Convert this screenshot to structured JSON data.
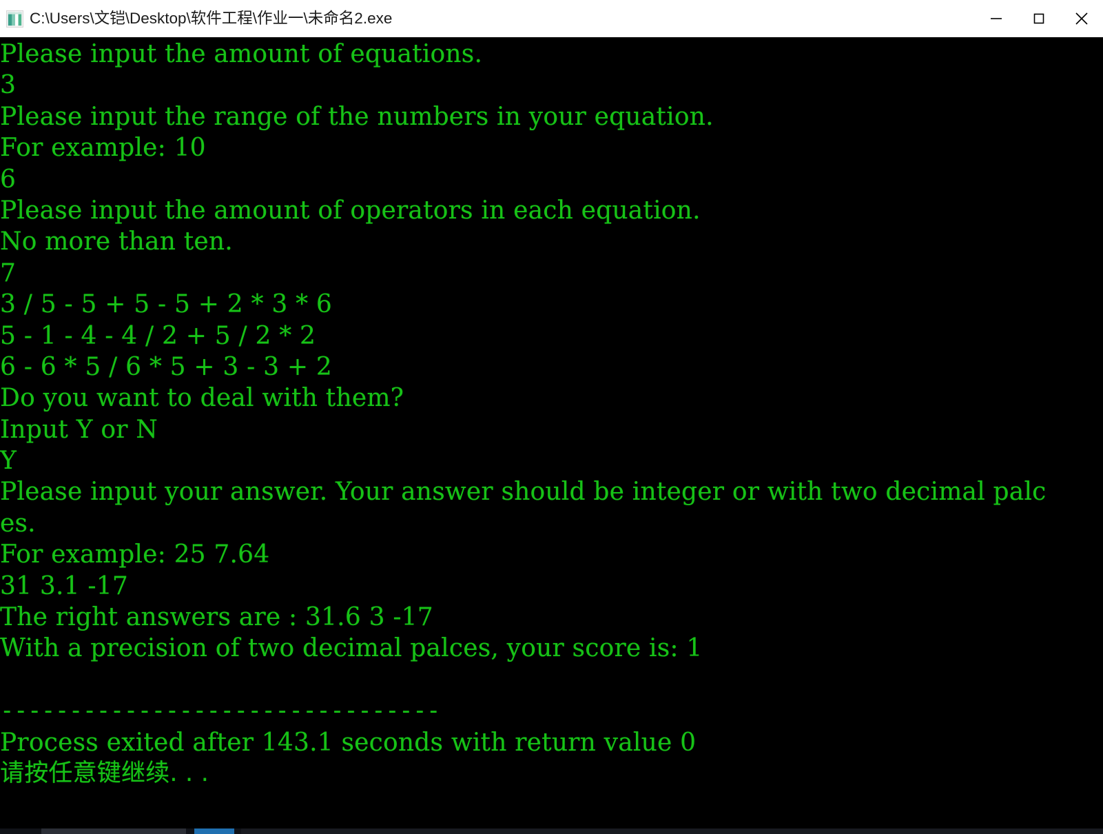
{
  "window": {
    "title": "C:\\Users\\文铠\\Desktop\\软件工程\\作业一\\未命名2.exe",
    "icon": "application-exe-icon",
    "background_color": "#000000",
    "titlebar_color": "#ffffff",
    "text_color": "#17c217",
    "controls": {
      "minimize_label": "—",
      "maximize_label": "□",
      "close_label": "✕"
    }
  },
  "console": {
    "lines": [
      {
        "text": "Please input the amount of equations.",
        "kind": "output"
      },
      {
        "text": "3",
        "kind": "input"
      },
      {
        "text": "Please input the range of the numbers in your equation.",
        "kind": "output"
      },
      {
        "text": "For example: 10",
        "kind": "output"
      },
      {
        "text": "6",
        "kind": "input"
      },
      {
        "text": "Please input the amount of operators in each equation.",
        "kind": "output"
      },
      {
        "text": "No more than ten.",
        "kind": "output"
      },
      {
        "text": "7",
        "kind": "input"
      },
      {
        "text": "3 / 5 - 5 + 5 - 5 + 2 * 3 * 6",
        "kind": "equation"
      },
      {
        "text": "5 - 1 - 4 - 4 / 2 + 5 / 2 * 2",
        "kind": "equation"
      },
      {
        "text": "6 - 6 * 5 / 6 * 5 + 3 - 3 + 2",
        "kind": "equation"
      },
      {
        "text": "Do you want to deal with them?",
        "kind": "output"
      },
      {
        "text": "Input Y or N",
        "kind": "output"
      },
      {
        "text": "Y",
        "kind": "input"
      },
      {
        "text": "Please input your answer. Your answer should be integer or with two decimal palc",
        "kind": "output"
      },
      {
        "text": "es.",
        "kind": "output"
      },
      {
        "text": "For example: 25 7.64",
        "kind": "output"
      },
      {
        "text": "31 3.1 -17",
        "kind": "input"
      },
      {
        "text": "The right answers are : 31.6 3 -17",
        "kind": "output"
      },
      {
        "text": "With a precision of two decimal palces, your score is: 1",
        "kind": "output"
      },
      {
        "text": "",
        "kind": "blank"
      },
      {
        "text": "--------------------------------",
        "kind": "divider"
      },
      {
        "text": "Process exited after 143.1 seconds with return value 0",
        "kind": "output"
      },
      {
        "text": "请按任意键继续. . .",
        "kind": "cjk"
      }
    ]
  },
  "session": {
    "equation_count": "3",
    "number_range": "6",
    "operator_count": "7",
    "deal_choice": "Y",
    "user_answers": "31 3.1 -17",
    "right_answers": "31.6 3 -17",
    "score": "1",
    "exit_seconds": "143.1",
    "return_value": "0"
  }
}
